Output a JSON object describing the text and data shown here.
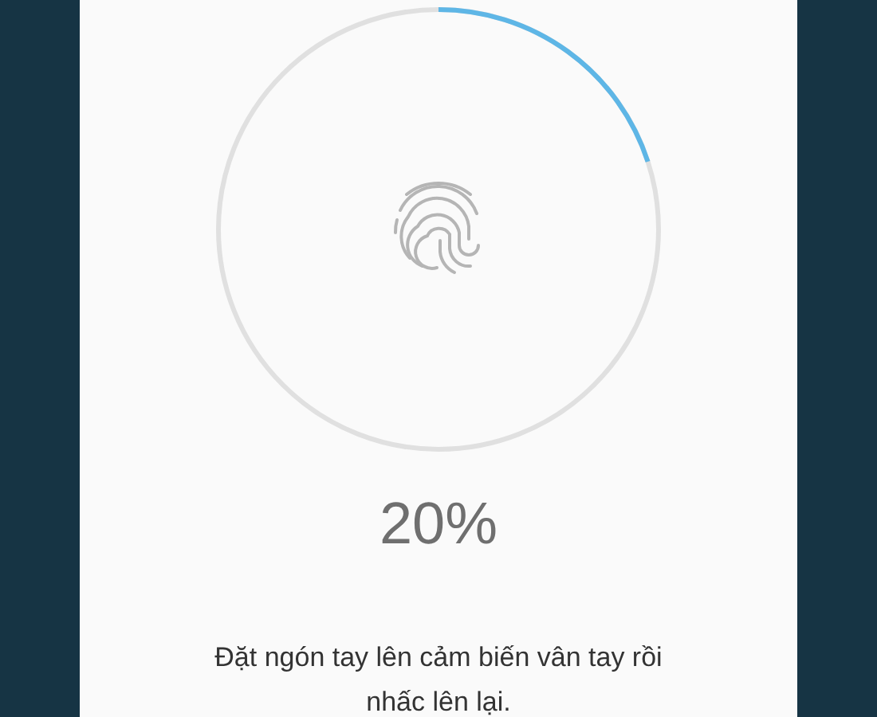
{
  "progress": {
    "percent": "20%"
  },
  "instruction": "Đặt ngón tay lên cảm biến vân tay rồi nhấc lên lại."
}
